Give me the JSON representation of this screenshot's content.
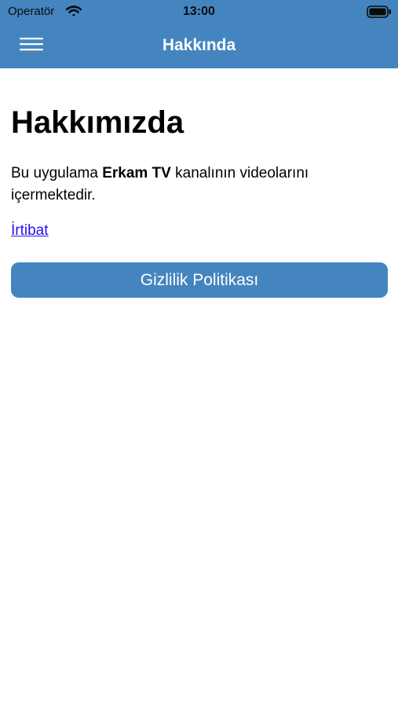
{
  "status_bar": {
    "carrier": "Operatör",
    "time": "13:00",
    "wifi_icon": "wifi-icon",
    "battery_icon": "battery-icon"
  },
  "nav": {
    "title": "Hakkında",
    "menu_icon": "hamburger-menu-icon"
  },
  "content": {
    "heading": "Hakkımızda",
    "description_prefix": "Bu uygulama ",
    "description_bold": "Erkam TV",
    "description_suffix": " kanalının videolarını içermektedir.",
    "contact_link": "İrtibat",
    "privacy_button": "Gizlilik Politikası"
  },
  "colors": {
    "primary": "#4585bf",
    "link": "#2212ee",
    "background": "#ffffff"
  }
}
